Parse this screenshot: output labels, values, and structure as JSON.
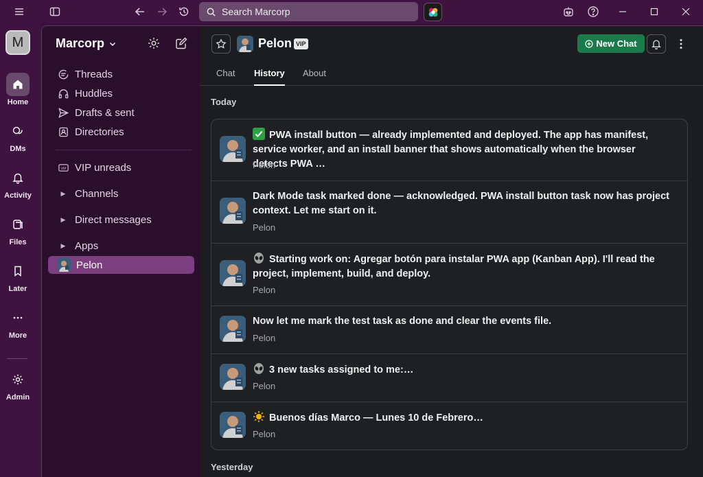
{
  "topbar": {
    "search_placeholder": "Search Marcorp"
  },
  "rail": {
    "workspace_initial": "M",
    "items": [
      {
        "label": "Home",
        "icon": "home-icon"
      },
      {
        "label": "DMs",
        "icon": "dms-icon"
      },
      {
        "label": "Activity",
        "icon": "bell-icon"
      },
      {
        "label": "Files",
        "icon": "files-icon"
      },
      {
        "label": "Later",
        "icon": "bookmark-icon"
      },
      {
        "label": "More",
        "icon": "more-icon"
      },
      {
        "label": "Admin",
        "icon": "gear-icon"
      }
    ]
  },
  "sidebar": {
    "workspace_name": "Marcorp",
    "nav": [
      {
        "label": "Threads",
        "icon": "threads-icon"
      },
      {
        "label": "Huddles",
        "icon": "headphones-icon"
      },
      {
        "label": "Drafts & sent",
        "icon": "send-icon"
      },
      {
        "label": "Directories",
        "icon": "directory-icon"
      }
    ],
    "sections": [
      {
        "label": "VIP unreads",
        "icon": "vip-icon"
      },
      {
        "label": "Channels"
      },
      {
        "label": "Direct messages"
      },
      {
        "label": "Apps"
      }
    ],
    "active_item": "Pelon"
  },
  "main": {
    "title": "Pelon",
    "badge": "VIP",
    "new_chat_label": "New Chat",
    "tabs": [
      {
        "label": "Chat",
        "active": false
      },
      {
        "label": "History",
        "active": true
      },
      {
        "label": "About",
        "active": false
      }
    ],
    "groups": [
      {
        "label": "Today",
        "items": [
          {
            "emoji": "check-mark-icon",
            "text": "PWA install button — already implemented and deployed. The app has manifest, service worker, and an install banner that shows automatically when the browser detects PWA …",
            "author": "Pelon"
          },
          {
            "emoji": "",
            "text": "Dark Mode task marked done — acknowledged. PWA install button task now has project context. Let me start on it.",
            "author": "Pelon"
          },
          {
            "emoji": "alien-icon",
            "text": "Starting work on: Agregar botón para instalar PWA app (Kanban App). I'll read the project, implement, build, and deploy.",
            "author": "Pelon"
          },
          {
            "emoji": "",
            "text": "Now let me mark the test task as done and clear the events file.",
            "author": "Pelon"
          },
          {
            "emoji": "alien-icon",
            "text": "3 new tasks assigned to me:…",
            "author": "Pelon"
          },
          {
            "emoji": "sun-icon",
            "text": "Buenos días Marco — Lunes 10 de Febrero…",
            "author": "Pelon"
          }
        ]
      },
      {
        "label": "Yesterday",
        "items": []
      }
    ]
  }
}
